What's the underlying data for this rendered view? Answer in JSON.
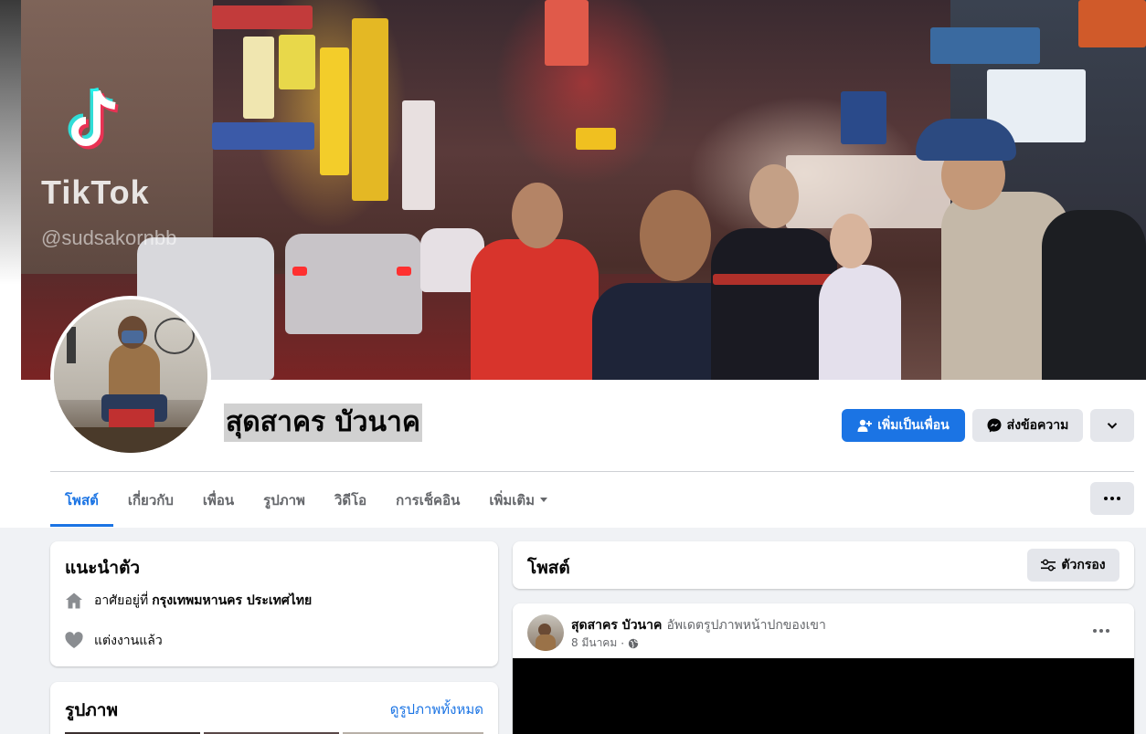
{
  "cover": {
    "watermark_brand": "TikTok",
    "watermark_user": "@sudsakornbb",
    "colors": {
      "tiktok_cyan": "#25f4ee",
      "tiktok_pink": "#fe2c55"
    }
  },
  "profile": {
    "name": "สุดสาคร บัวนาค"
  },
  "actions": {
    "add_friend": "เพิ่มเป็นเพื่อน",
    "message": "ส่งข้อความ",
    "add_friend_icon": "add-friend-icon",
    "message_icon": "messenger-icon",
    "more_icon": "chevron-down-icon"
  },
  "tabs": [
    {
      "label": "โพสต์",
      "active": true
    },
    {
      "label": "เกี่ยวกับ",
      "active": false
    },
    {
      "label": "เพื่อน",
      "active": false
    },
    {
      "label": "รูปภาพ",
      "active": false
    },
    {
      "label": "วิดีโอ",
      "active": false
    },
    {
      "label": "การเช็คอิน",
      "active": false
    },
    {
      "label": "เพิ่มเติม",
      "active": false
    }
  ],
  "intro": {
    "title": "แนะนำตัว",
    "lives_in_prefix": "อาศัยอยู่ที่",
    "lives_in_place": "กรุงเทพมหานคร ประเทศไทย",
    "relationship": "แต่งงานแล้ว"
  },
  "photos": {
    "title": "รูปภาพ",
    "see_all": "ดูรูปภาพทั้งหมด"
  },
  "posts_header": {
    "title": "โพสต์",
    "filter": "ตัวกรอง"
  },
  "post": {
    "author": "สุดสาคร บัวนาค",
    "activity": "อัพเดตรูปภาพหน้าปกของเขา",
    "date": "8 มีนาคม",
    "separator": "·",
    "privacy_icon": "globe-icon"
  },
  "colors": {
    "accent": "#1b74e4",
    "background": "#f0f2f5",
    "secondary_text": "#65676b"
  }
}
